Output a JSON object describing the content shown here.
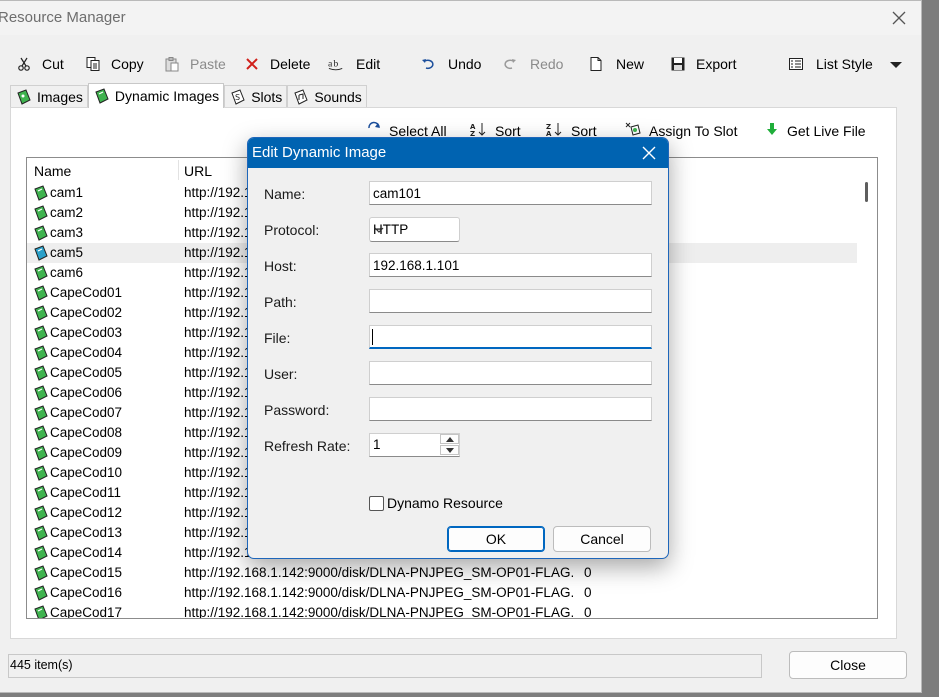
{
  "window": {
    "title": "Resource Manager"
  },
  "toolbar": {
    "cut": "Cut",
    "copy": "Copy",
    "paste": "Paste",
    "delete": "Delete",
    "edit": "Edit",
    "undo": "Undo",
    "redo": "Redo",
    "new": "New",
    "export": "Export",
    "list_style": "List Style"
  },
  "tabs": [
    {
      "label": "Images"
    },
    {
      "label": "Dynamic Images"
    },
    {
      "label": "Slots"
    },
    {
      "label": "Sounds"
    }
  ],
  "actions": {
    "select_all": "Select All",
    "sort_az": "Sort",
    "sort_za": "Sort",
    "assign_to_slot": "Assign To Slot",
    "get_live_file": "Get Live File"
  },
  "list": {
    "columns": {
      "name": "Name",
      "url": "URL"
    },
    "rows": [
      {
        "name": "cam1",
        "url": "http://192.1",
        "num": ""
      },
      {
        "name": "cam2",
        "url": "http://192.1",
        "num": ""
      },
      {
        "name": "cam3",
        "url": "http://192.1",
        "num": ""
      },
      {
        "name": "cam5",
        "url": "http://192.1",
        "num": ""
      },
      {
        "name": "cam6",
        "url": "http://192.1",
        "num": ""
      },
      {
        "name": "CapeCod01",
        "url": "http://192.1",
        "num": ""
      },
      {
        "name": "CapeCod02",
        "url": "http://192.1",
        "num": ""
      },
      {
        "name": "CapeCod03",
        "url": "http://192.1",
        "num": ""
      },
      {
        "name": "CapeCod04",
        "url": "http://192.1",
        "num": ""
      },
      {
        "name": "CapeCod05",
        "url": "http://192.1",
        "num": ""
      },
      {
        "name": "CapeCod06",
        "url": "http://192.1",
        "num": ""
      },
      {
        "name": "CapeCod07",
        "url": "http://192.1",
        "num": ""
      },
      {
        "name": "CapeCod08",
        "url": "http://192.1",
        "num": ""
      },
      {
        "name": "CapeCod09",
        "url": "http://192.1",
        "num": ""
      },
      {
        "name": "CapeCod10",
        "url": "http://192.1",
        "num": ""
      },
      {
        "name": "CapeCod11",
        "url": "http://192.1",
        "num": ""
      },
      {
        "name": "CapeCod12",
        "url": "http://192.1",
        "num": ""
      },
      {
        "name": "CapeCod13",
        "url": "http://192.1",
        "num": ""
      },
      {
        "name": "CapeCod14",
        "url": "http://192.1",
        "num": ""
      },
      {
        "name": "CapeCod15",
        "url": "http://192.168.1.142:9000/disk/DLNA-PNJPEG_SM-OP01-FLAG...",
        "num": "0"
      },
      {
        "name": "CapeCod16",
        "url": "http://192.168.1.142:9000/disk/DLNA-PNJPEG_SM-OP01-FLAG...",
        "num": "0"
      },
      {
        "name": "CapeCod17",
        "url": "http://192.168.1.142:9000/disk/DLNA-PNJPEG_SM-OP01-FLAG...",
        "num": "0"
      }
    ]
  },
  "status": {
    "count": "445 item(s)"
  },
  "close_button": "Close",
  "dialog": {
    "title": "Edit Dynamic Image",
    "labels": {
      "name": "Name:",
      "protocol": "Protocol:",
      "host": "Host:",
      "path": "Path:",
      "file": "File:",
      "user": "User:",
      "password": "Password:",
      "refresh_rate": "Refresh Rate:"
    },
    "values": {
      "name": "cam101",
      "protocol": "HTTP",
      "host": "192.168.1.101",
      "path": "",
      "file": "",
      "user": "",
      "password": "",
      "refresh_rate": "1"
    },
    "dynamo_resource": "Dynamo Resource",
    "ok": "OK",
    "cancel": "Cancel"
  },
  "colors": {
    "accent": "#0063b1",
    "icon_green": "#2fa84f"
  }
}
